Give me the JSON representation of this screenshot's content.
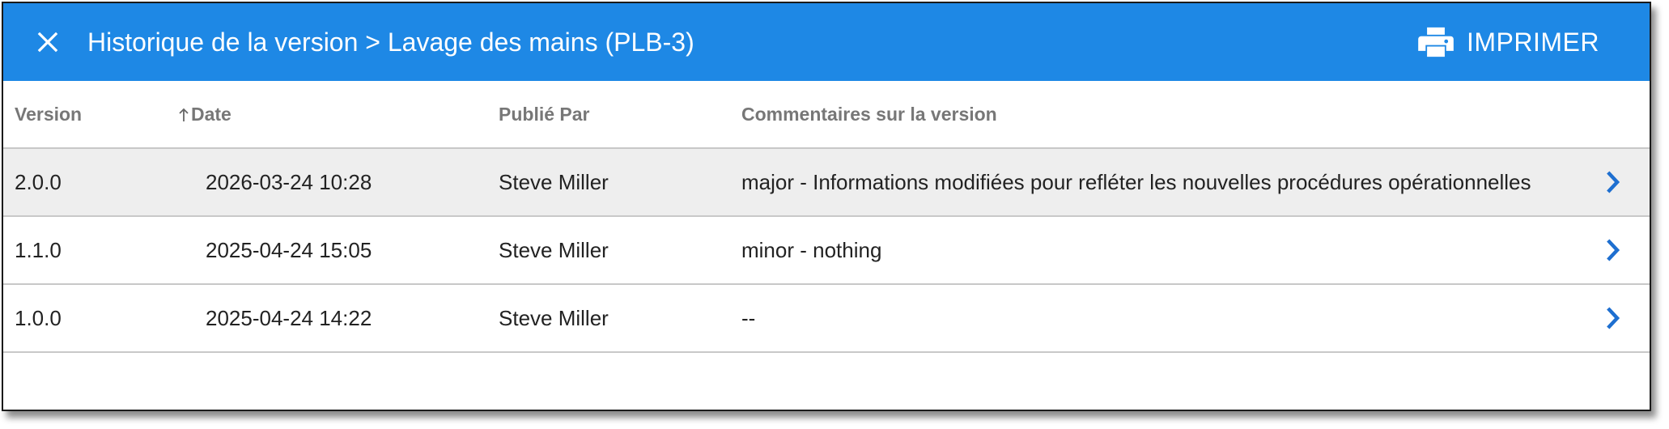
{
  "header": {
    "title": "Historique de la version > Lavage des mains (PLB-3)",
    "print_label": "IMPRIMER",
    "close_icon": "close-icon",
    "print_icon": "printer-icon",
    "background_color": "#1e88e5"
  },
  "table": {
    "columns": {
      "version": "Version",
      "date": "Date",
      "published_by": "Publié Par",
      "comments": "Commentaires sur la version"
    },
    "sort": {
      "column": "date",
      "direction": "ascending",
      "icon": "arrow-up-icon"
    },
    "rows": [
      {
        "version": "2.0.0",
        "date": "2026-03-24 10:28",
        "published_by": "Steve Miller",
        "comments": "major - Informations modifiées pour refléter les nouvelles procédures opérationnelles",
        "selected": true
      },
      {
        "version": "1.1.0",
        "date": "2025-04-24 15:05",
        "published_by": "Steve Miller",
        "comments": "minor - nothing",
        "selected": false
      },
      {
        "version": "1.0.0",
        "date": "2025-04-24 14:22",
        "published_by": "Steve Miller",
        "comments": "--",
        "selected": false
      }
    ],
    "row_action_icon": "chevron-right-icon",
    "accent_color": "#1e88e5"
  }
}
